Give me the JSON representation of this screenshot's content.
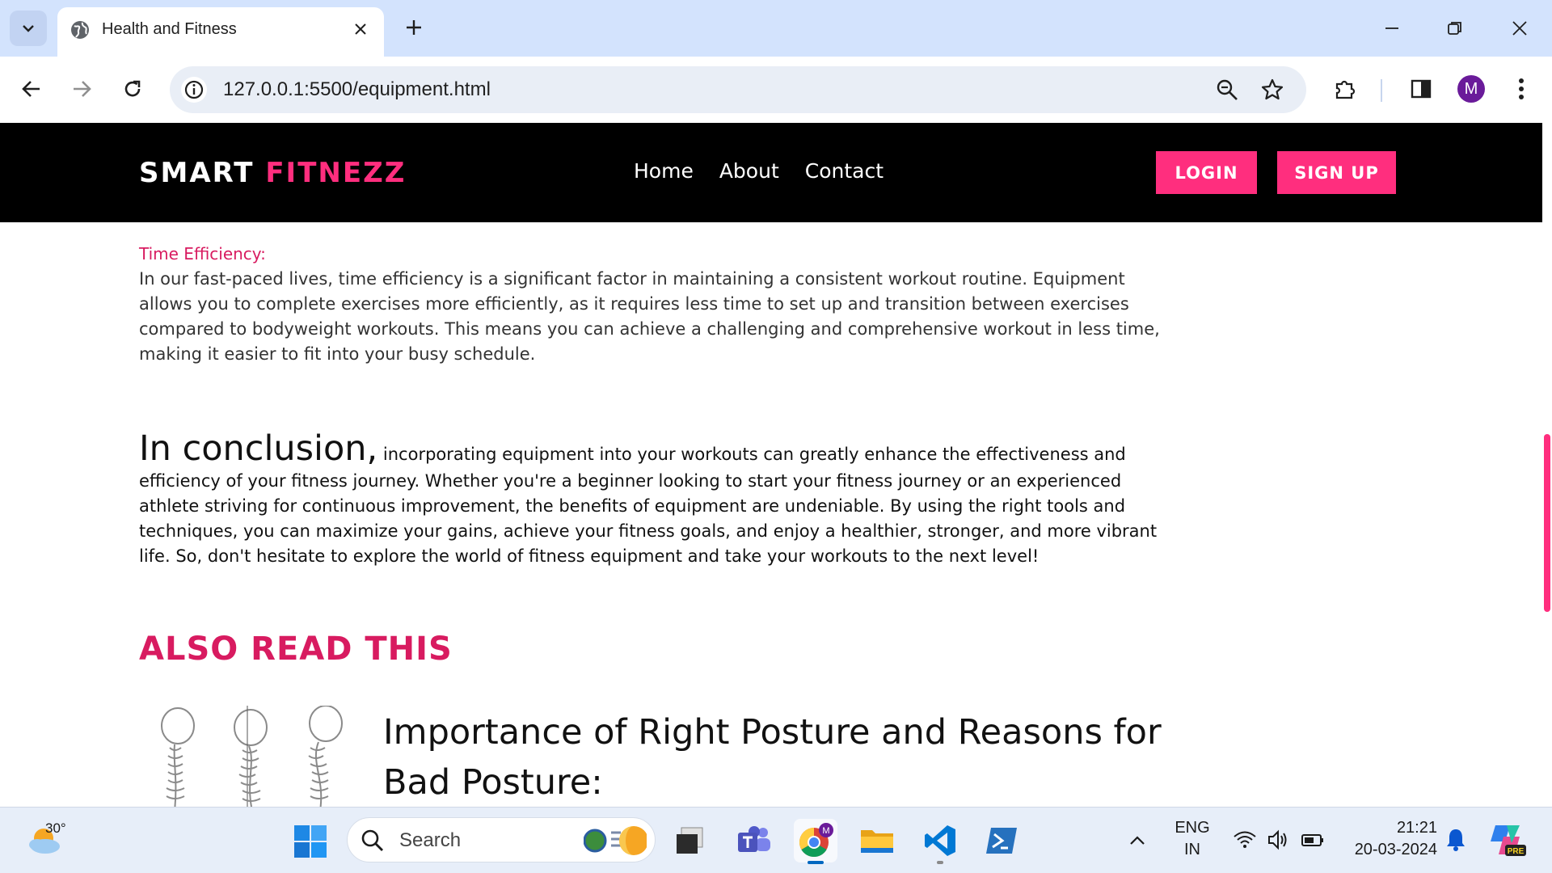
{
  "browser": {
    "tab_title": "Health and Fitness",
    "url": "127.0.0.1:5500/equipment.html",
    "profile_initial": "M"
  },
  "site": {
    "logo_part1": "SMART",
    "logo_part2": "FITNEZZ",
    "menu": [
      "Home",
      "About",
      "Contact"
    ],
    "login_label": "LOGIN",
    "signup_label": "SIGN UP",
    "accent_color": "#ff2e7e"
  },
  "article": {
    "time_heading": "Time Efficiency:",
    "time_paragraph": "In our fast-paced lives, time efficiency is a significant factor in maintaining a consistent workout routine. Equipment allows you to complete exercises more efficiently, as it requires less time to set up and transition between exercises compared to bodyweight workouts. This means you can achieve a challenging and comprehensive workout in less time, making it easier to fit into your busy schedule.",
    "conclusion_lead": "In conclusion,",
    "conclusion_text": " incorporating equipment into your workouts can greatly enhance the effectiveness and efficiency of your fitness journey. Whether you're a beginner looking to start your fitness journey or an experienced athlete striving for continuous improvement, the benefits of equipment are undeniable. By using the right tools and techniques, you can maximize your gains, achieve your fitness goals, and enjoy a healthier, stronger, and more vibrant life. So, don't hesitate to explore the world of fitness equipment and take your workouts to the next level!",
    "also_read_title": "ALSO READ THIS",
    "related_title": "Importance of Right Posture and Reasons for Bad Posture:"
  },
  "taskbar": {
    "temperature": "30°",
    "search_placeholder": "Search",
    "lang_line1": "ENG",
    "lang_line2": "IN",
    "time": "21:21",
    "date": "20-03-2024",
    "apps": [
      "file-explorer-taskview",
      "teams",
      "chrome",
      "file-explorer",
      "vscode",
      "powershell"
    ]
  }
}
